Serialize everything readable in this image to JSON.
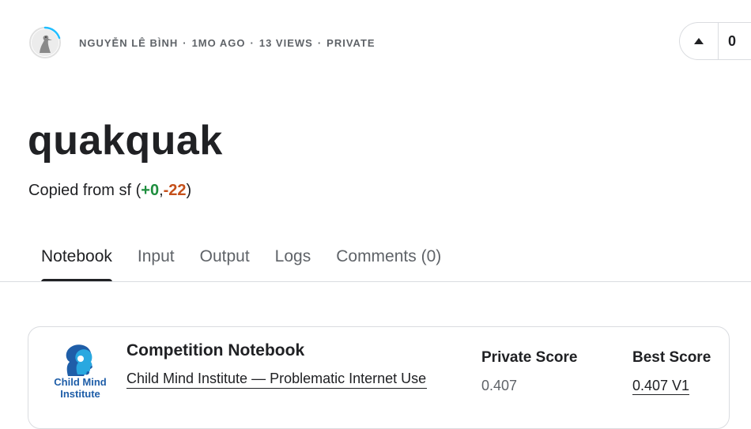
{
  "meta": {
    "author": "NGUYỄN LÊ BÌNH",
    "separator": "·",
    "time": "1MO AGO",
    "views": "13 VIEWS",
    "visibility": "PRIVATE"
  },
  "vote": {
    "count": "0"
  },
  "notebook": {
    "title": "quakquak",
    "copied_prefix": "Copied from sf (",
    "plus": "+0",
    "comma": ",",
    "minus": "-22",
    "close": ")"
  },
  "tabs": [
    {
      "label": "Notebook"
    },
    {
      "label": "Input"
    },
    {
      "label": "Output"
    },
    {
      "label": "Logs"
    },
    {
      "label": "Comments (0)"
    }
  ],
  "competition": {
    "heading": "Competition Notebook",
    "name": "Child Mind Institute — Problematic Internet Use",
    "logo_text_line1": "Child Mind",
    "logo_text_line2": "Institute",
    "private_score_label": "Private Score",
    "private_score_value": "0.407",
    "best_score_label": "Best Score",
    "best_score_value": "0.407 V1"
  },
  "colors": {
    "accent_green": "#1e8e3e",
    "accent_orange": "#c5501a",
    "logo_blue": "#1f5ea8",
    "logo_cyan": "#29a8e0"
  },
  "icons": {
    "avatar": "bird-avatar-icon",
    "upvote": "triangle-up-icon",
    "logo": "child-mind-head-icon"
  }
}
